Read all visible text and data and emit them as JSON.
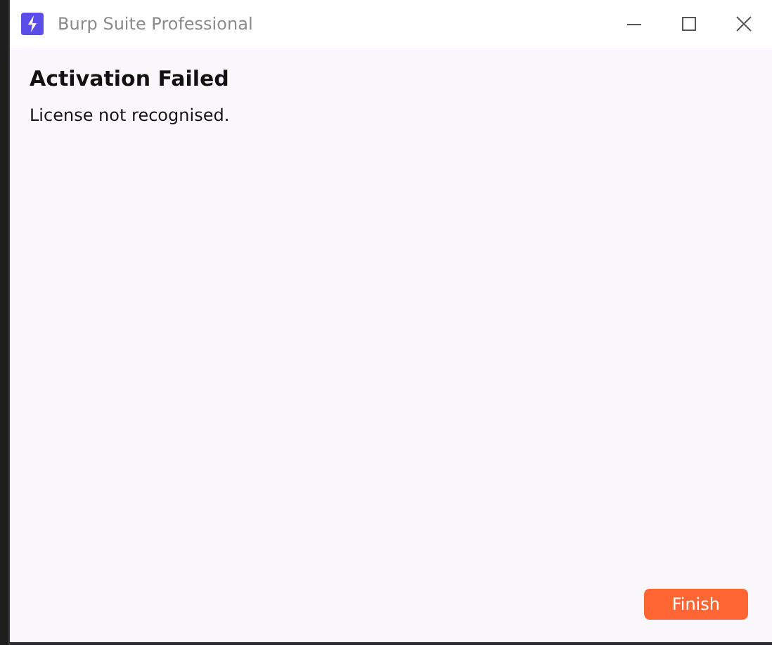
{
  "window": {
    "title": "Burp Suite Professional"
  },
  "heading": "Activation Failed",
  "message": "License not recognised.",
  "buttons": [
    {
      "label": "Finish",
      "kind": "primary"
    }
  ]
}
